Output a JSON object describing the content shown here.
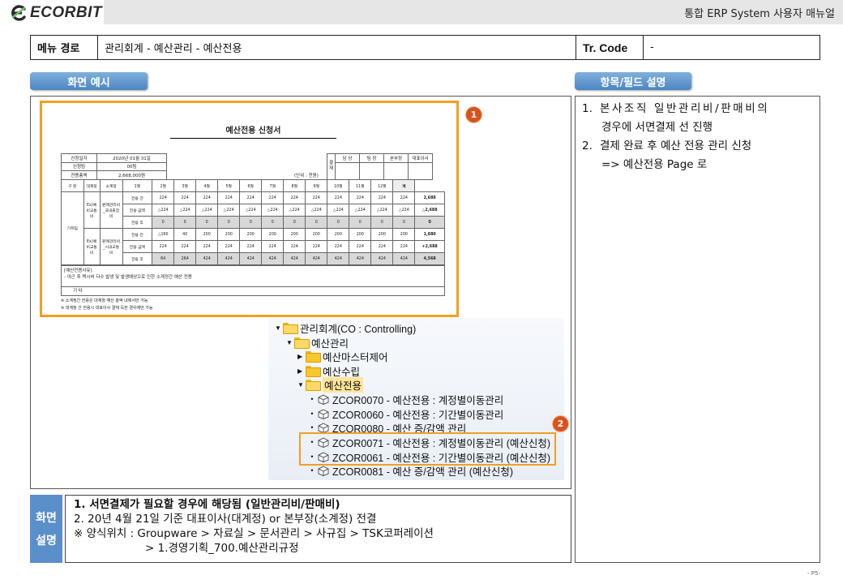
{
  "header": {
    "logo_text": "ECORBIT",
    "doc_title": "통합 ERP System 사용자 매뉴얼"
  },
  "menu_path": {
    "label": "메뉴 경로",
    "value": "관리회계 - 예산관리 - 예산전용",
    "tr_label": "Tr. Code",
    "tr_value": "-"
  },
  "sections": {
    "screen_example": "화면 예시",
    "field_desc": "항목/필드 설명"
  },
  "form": {
    "title": "예산전용 신청서",
    "info_rows": [
      {
        "label": "신청일자",
        "value": "2020년 01월 31일"
      },
      {
        "label": "신청팀",
        "value": "00팀"
      },
      {
        "label": "전용총액",
        "value": "2,668,000원"
      }
    ],
    "sign_side": "결 재",
    "sign_headers": [
      "담 당",
      "팀 장",
      "본부장",
      "대표이사"
    ],
    "unit": "(단위 : 천원)",
    "col_headers": [
      "구 분",
      "대계정",
      "소계정",
      "1월",
      "2월",
      "3월",
      "4월",
      "5월",
      "6월",
      "7월",
      "8월",
      "9월",
      "10월",
      "11월",
      "12월",
      "계"
    ],
    "team": "기획팀",
    "groups": [
      {
        "major": "Ex)예비교통비",
        "minor": "판매관리비_국내출장비",
        "rows": [
          {
            "label": "전용 전",
            "values": [
              "224",
              "224",
              "224",
              "224",
              "224",
              "224",
              "224",
              "224",
              "224",
              "224",
              "224",
              "224"
            ],
            "total": "2,688"
          },
          {
            "label": "전용 금액",
            "values": [
              "△224",
              "△224",
              "△224",
              "△224",
              "△224",
              "△224",
              "△224",
              "△224",
              "△224",
              "△224",
              "△224",
              "△224"
            ],
            "total": "△2,688"
          },
          {
            "label": "전용 후",
            "values": [
              "0",
              "0",
              "0",
              "0",
              "0",
              "0",
              "0",
              "0",
              "0",
              "0",
              "0",
              "0"
            ],
            "total": "0"
          }
        ]
      },
      {
        "major": "Ex)예비교통비",
        "minor": "판매관리비_시내교통비",
        "rows": [
          {
            "label": "전용 전",
            "values": [
              "△160",
              "40",
              "200",
              "200",
              "200",
              "200",
              "200",
              "200",
              "200",
              "200",
              "200",
              "200"
            ],
            "total": "1,880"
          },
          {
            "label": "전용 금액",
            "values": [
              "224",
              "224",
              "224",
              "224",
              "224",
              "224",
              "224",
              "224",
              "224",
              "224",
              "224",
              "224"
            ],
            "total": "+2,688"
          },
          {
            "label": "전용 후",
            "values": [
              "64",
              "264",
              "424",
              "424",
              "424",
              "424",
              "424",
              "424",
              "424",
              "424",
              "424",
              "424"
            ],
            "total": "4,568"
          }
        ]
      }
    ],
    "reason_title": "[예산전용사유]",
    "reason_text": "- 야근 후 택시비 다수 발생 및 발생예상으로 인한 소계정간 예산 전용",
    "etc_label": "기 타",
    "notes": [
      "※ 소계정간 전용은 대계정 예산 총액 내에서만 가능",
      "※ 대계정 간 전용시 대표이사 결재 득한 경우에만 가능"
    ]
  },
  "badges": [
    "1",
    "2"
  ],
  "tree": {
    "items": [
      {
        "type": "folder",
        "open": true,
        "label": "관리회계(CO : Controlling)"
      },
      {
        "type": "folder",
        "open": true,
        "label": "예산관리"
      },
      {
        "type": "folder",
        "open": false,
        "label": "예산마스터제어"
      },
      {
        "type": "folder",
        "open": false,
        "label": "예산수립"
      },
      {
        "type": "folder",
        "open": true,
        "label": "예산전용"
      },
      {
        "type": "tx",
        "label": "ZCOR0070 - 예산전용 : 계정별이동관리"
      },
      {
        "type": "tx",
        "label": "ZCOR0060 - 예산전용 : 기간별이동관리"
      },
      {
        "type": "tx",
        "label": "ZCOR0080 - 예산 증/감액 관리"
      },
      {
        "type": "tx",
        "label": "ZCOR0071 - 예산전용 : 계정별이동관리 (예산신청)"
      },
      {
        "type": "tx",
        "label": "ZCOR0061 - 예산전용 : 기간별이동관리 (예산신청)"
      },
      {
        "type": "tx",
        "label": "ZCOR0081 - 예산 증/감액 관리 (예산신청)"
      }
    ]
  },
  "field_items": [
    {
      "num": "1.",
      "text": "본사조직 일반관리비/판매비의",
      "cont": "경우에 서면결제 선 진행"
    },
    {
      "num": "2.",
      "text": "결제 완료 후  예산 전용 관리 신청",
      "cont": "=> 예산전용 Page 로"
    }
  ],
  "description": {
    "side_top": "화면",
    "side_bottom": "설명",
    "line1": "1.   서면결제가 필요할 경우에 해당됨 (일반관리비/판매비)",
    "line2": "2.  20년 4월 21일 기준 대표이사(대계정) or 본부장(소계정) 전결",
    "line3": "※ 양식위치 : Groupware > 자료실 > 문서관리 > 사규집 > TSK코퍼레이션",
    "line4": "> 1.경영기획_700.예산관리규정"
  },
  "page_number": "- P5-",
  "colors": {
    "accent_blue": "#5b8fc9",
    "highlight_orange": "#f0a020",
    "badge_red": "#d9531e"
  }
}
